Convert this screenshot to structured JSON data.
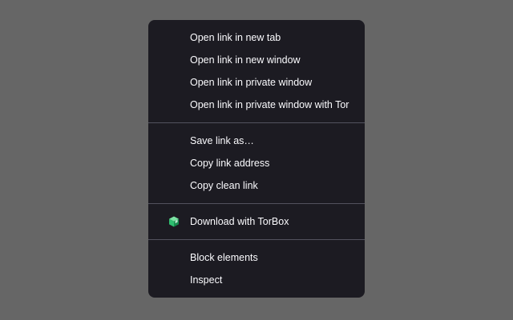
{
  "context_menu": {
    "groups": [
      {
        "items": [
          {
            "label": "Open link in new tab"
          },
          {
            "label": "Open link in new window"
          },
          {
            "label": "Open link in private window"
          },
          {
            "label": "Open link in private window with Tor"
          }
        ]
      },
      {
        "items": [
          {
            "label": "Save link as…"
          },
          {
            "label": "Copy link address"
          },
          {
            "label": "Copy clean link"
          }
        ]
      },
      {
        "items": [
          {
            "label": "Download with TorBox",
            "icon": "torbox-icon"
          }
        ]
      },
      {
        "items": [
          {
            "label": "Block elements"
          },
          {
            "label": "Inspect"
          }
        ]
      }
    ]
  },
  "colors": {
    "backdrop": "#666666",
    "menu_background": "#1c1b22",
    "menu_text": "#fbfbfe",
    "separator": "#52525e",
    "torbox_green": "#2fbf71"
  }
}
